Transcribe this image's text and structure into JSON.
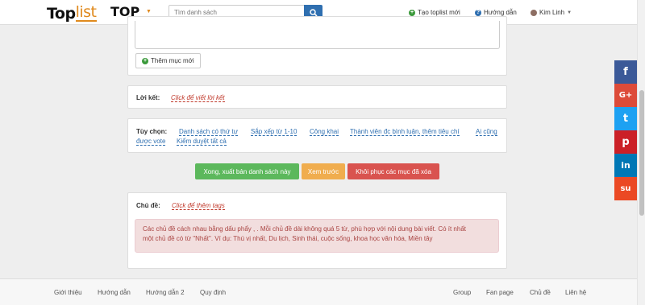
{
  "header": {
    "logo_part1": "Top",
    "logo_part2": "list",
    "top_label": "TOP",
    "search_placeholder": "Tìm danh sách",
    "create_label": "Tạo toplist mới",
    "guide_label": "Hướng dẫn",
    "user_label": "Kim Linh"
  },
  "list_editor": {
    "add_item_label": "Thêm mục mới"
  },
  "conclusion": {
    "label": "Lời kết:",
    "link": "Click để viết lời kết"
  },
  "options": {
    "label": "Tùy chọn:",
    "items": [
      "Danh sách có thứ tự",
      "Sắp xếp từ 1-10",
      "Công khai",
      "Thành viên đc bình luận, thêm tiêu chí",
      "Ai cũng",
      "được vote",
      "Kiểm duyệt tất cả"
    ]
  },
  "actions": {
    "publish": "Xong, xuất bản danh sách này",
    "preview": "Xem trước",
    "restore": "Khôi phục các mục đã xóa"
  },
  "topics": {
    "label": "Chủ đề:",
    "link": "Click để thêm tags",
    "note_line1": "Các chủ đề cách nhau bằng dấu phẩy , . Mỗi chủ đề dài không quá 5 từ, phù hợp với nội dung bài viết. Có ít nhất",
    "note_line2": "một chủ đề có từ \"Nhất\". Ví dụ: Thú vị nhất, Du lịch, Sinh thái, cuộc sống, khoa học văn hóa, Miền tây"
  },
  "footer": {
    "left": [
      "Giới thiệu",
      "Hướng dẫn",
      "Hướng dẫn 2",
      "Quy định"
    ],
    "right": [
      "Group",
      "Fan page",
      "Chủ đề",
      "Liên hệ"
    ]
  },
  "social": [
    {
      "icon": "facebook-icon",
      "glyph": "f",
      "color": "#3b5998"
    },
    {
      "icon": "google-plus-icon",
      "glyph": "G+",
      "color": "#dd4b39"
    },
    {
      "icon": "twitter-icon",
      "glyph": "t",
      "color": "#1da1f2"
    },
    {
      "icon": "pinterest-icon",
      "glyph": "p",
      "color": "#cb2027"
    },
    {
      "icon": "linkedin-icon",
      "glyph": "in",
      "color": "#0077b5"
    },
    {
      "icon": "stumbleupon-icon",
      "glyph": "su",
      "color": "#eb4924"
    }
  ],
  "colors": {
    "publish": "#5cb85c",
    "preview": "#f0ad4e",
    "restore": "#d9534f",
    "search_button": "#2f6fb0"
  }
}
